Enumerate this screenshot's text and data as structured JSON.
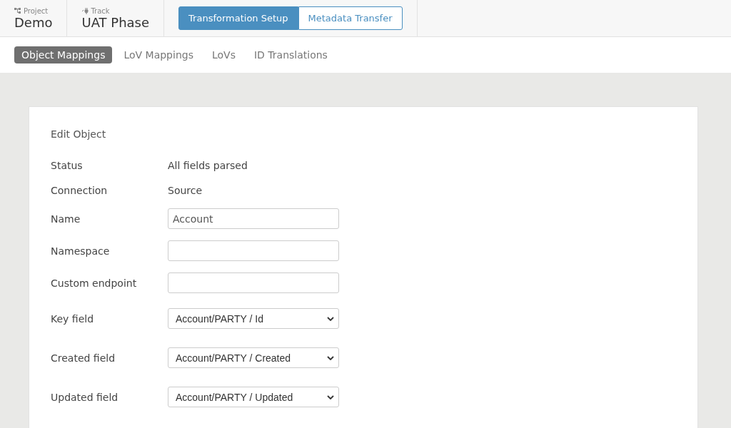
{
  "header": {
    "project": {
      "label": "Project",
      "value": "Demo"
    },
    "track": {
      "label": "Track",
      "value": "UAT Phase"
    },
    "modes": [
      {
        "label": "Transformation Setup",
        "selected": true
      },
      {
        "label": "Metadata Transfer",
        "selected": false
      }
    ]
  },
  "tabs": [
    {
      "label": "Object Mappings",
      "selected": true
    },
    {
      "label": "LoV Mappings",
      "selected": false
    },
    {
      "label": "LoVs",
      "selected": false
    },
    {
      "label": "ID Translations",
      "selected": false
    }
  ],
  "form": {
    "title": "Edit Object",
    "rows": [
      {
        "kind": "text",
        "label": "Status",
        "value": "All fields parsed"
      },
      {
        "kind": "text",
        "label": "Connection",
        "value": "Source"
      },
      {
        "kind": "input",
        "label": "Name",
        "value": "Account"
      },
      {
        "kind": "input",
        "label": "Namespace"
      },
      {
        "kind": "input",
        "label": "Custom endpoint"
      },
      {
        "kind": "select",
        "label": "Key field",
        "value": "Account/PARTY / Id"
      },
      {
        "kind": "select",
        "label": "Created field",
        "value": "Account/PARTY / Created"
      },
      {
        "kind": "select",
        "label": "Updated field",
        "value": "Account/PARTY / Updated"
      }
    ]
  }
}
